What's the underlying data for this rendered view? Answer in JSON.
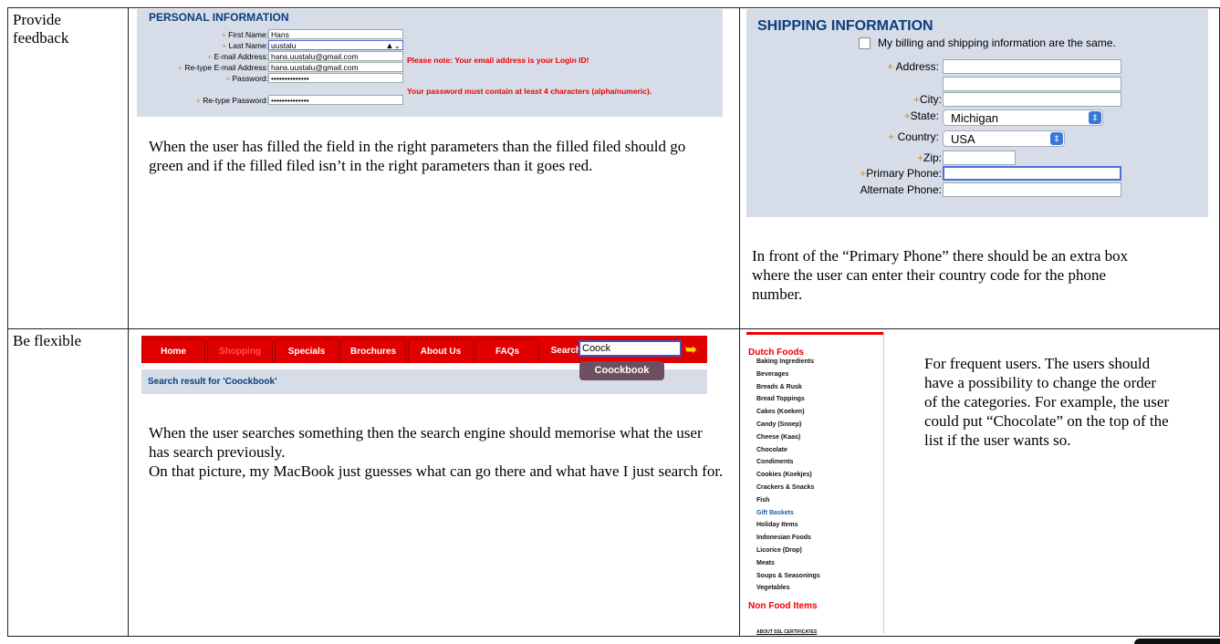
{
  "rows": [
    {
      "label": "Provide\nfeedback"
    },
    {
      "label": "Be flexible"
    }
  ],
  "personal_info": {
    "title": "PERSONAL INFORMATION",
    "fields": [
      {
        "label": "First Name:",
        "value": "Hans"
      },
      {
        "label": "Last Name:",
        "value": "uustalu"
      },
      {
        "label": "E-mail Address:",
        "value": "hans.uustalu@gmail.com"
      },
      {
        "label": "Re-type E-mail Address:",
        "value": "hans.uustalu@gmail.com"
      },
      {
        "label": "Password:",
        "value": "••••••••••••••"
      },
      {
        "label": "Re-type Password:",
        "value": "••••••••••••••"
      }
    ],
    "errors": {
      "email": "Please note: Your email address is your Login ID!",
      "password": "Your password must contain at least 4 characters (alpha/numeric)."
    }
  },
  "feedback_text": "When the user has filled the field in the right parameters than the filled filed should go green and if the filled filed isn’t in the right parameters than it goes red.",
  "shipping_info": {
    "title": "SHIPPING INFORMATION",
    "same_label": "My billing and shipping information are the same.",
    "address_label": "Address:",
    "city_label": "City:",
    "state_label": "State:",
    "state_value": "Michigan",
    "country_label": "Country:",
    "country_value": "USA",
    "zip_label": "Zip:",
    "primary_label": "Primary Phone:",
    "alternate_label": "Alternate Phone:"
  },
  "shipping_text": "In front of the “Primary Phone” there should be an extra box where the user can enter their country code for the phone number.",
  "nav": {
    "tabs": [
      "Home",
      "Shopping",
      "Specials",
      "Brochures",
      "About Us",
      "FAQs"
    ],
    "search_label": "Search",
    "search_value": "Coock",
    "suggestion": "Coockbook",
    "result": "Search result for 'Coockbook'"
  },
  "search_text": "When the user searches something then the search engine should memorise what the user has search previously.\n On that picture, my MacBook just guesses what can go there and what have I just search for.",
  "categories": {
    "head1": "Dutch Foods",
    "items": [
      "Baking Ingredients",
      "Beverages",
      "Breads & Rusk",
      "Bread Toppings",
      "Cakes (Koeken)",
      "Candy (Snoep)",
      "Cheese (Kaas)",
      "Chocolate",
      "Condiments",
      "Cookies (Koekjes)",
      "Crackers & Snacks",
      "Fish",
      "Gift Baskets",
      "Holiday Items",
      "Indonesian Foods",
      "Licorice (Drop)",
      "Meats",
      "Soups & Seasonings",
      "Vegetables"
    ],
    "head2": "Non Food Items",
    "footer": "ABOUT SSL CERTIFICATES"
  },
  "categories_text": "For frequent users. The users should have a possibility to change the order of the categories. For example, the user could put “Chocolate” on the top of the list if the user wants so.",
  "colors": {
    "accent_red": "#e00000",
    "panel_blue": "#d6dde8",
    "title_blue": "#0b3e7c"
  }
}
